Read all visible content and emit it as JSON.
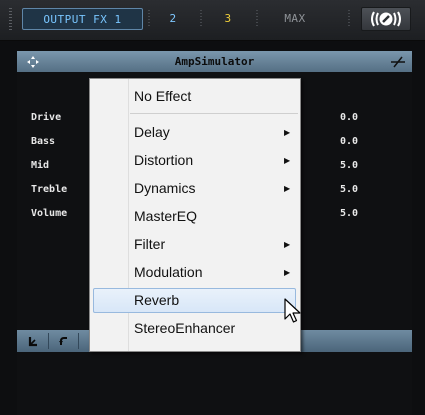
{
  "topbar": {
    "output_tab": "OUTPUT FX 1",
    "tab2": "2",
    "tab3": "3",
    "max_tab": "MAX",
    "power_icon": "power-icon"
  },
  "panel": {
    "title": "AmpSimulator",
    "params": [
      {
        "label": "Drive",
        "value": "0.0"
      },
      {
        "label": "Bass",
        "value": "0.0"
      },
      {
        "label": "Mid",
        "value": "5.0"
      },
      {
        "label": "Treble",
        "value": "5.0"
      },
      {
        "label": "Volume",
        "value": "5.0"
      }
    ]
  },
  "menu": {
    "items": [
      {
        "label": "No Effect",
        "submenu": false
      },
      {
        "label": "Delay",
        "submenu": true
      },
      {
        "label": "Distortion",
        "submenu": true
      },
      {
        "label": "Dynamics",
        "submenu": true
      },
      {
        "label": "MasterEQ",
        "submenu": false
      },
      {
        "label": "Filter",
        "submenu": true
      },
      {
        "label": "Modulation",
        "submenu": true
      },
      {
        "label": "Reverb",
        "submenu": false,
        "highlighted": true
      },
      {
        "label": "StereoEnhancer",
        "submenu": false
      }
    ]
  },
  "colors": {
    "accent_blue": "#79c6ff",
    "accent_yellow": "#f0cf3a",
    "titlebar": "#6d8aa0"
  }
}
